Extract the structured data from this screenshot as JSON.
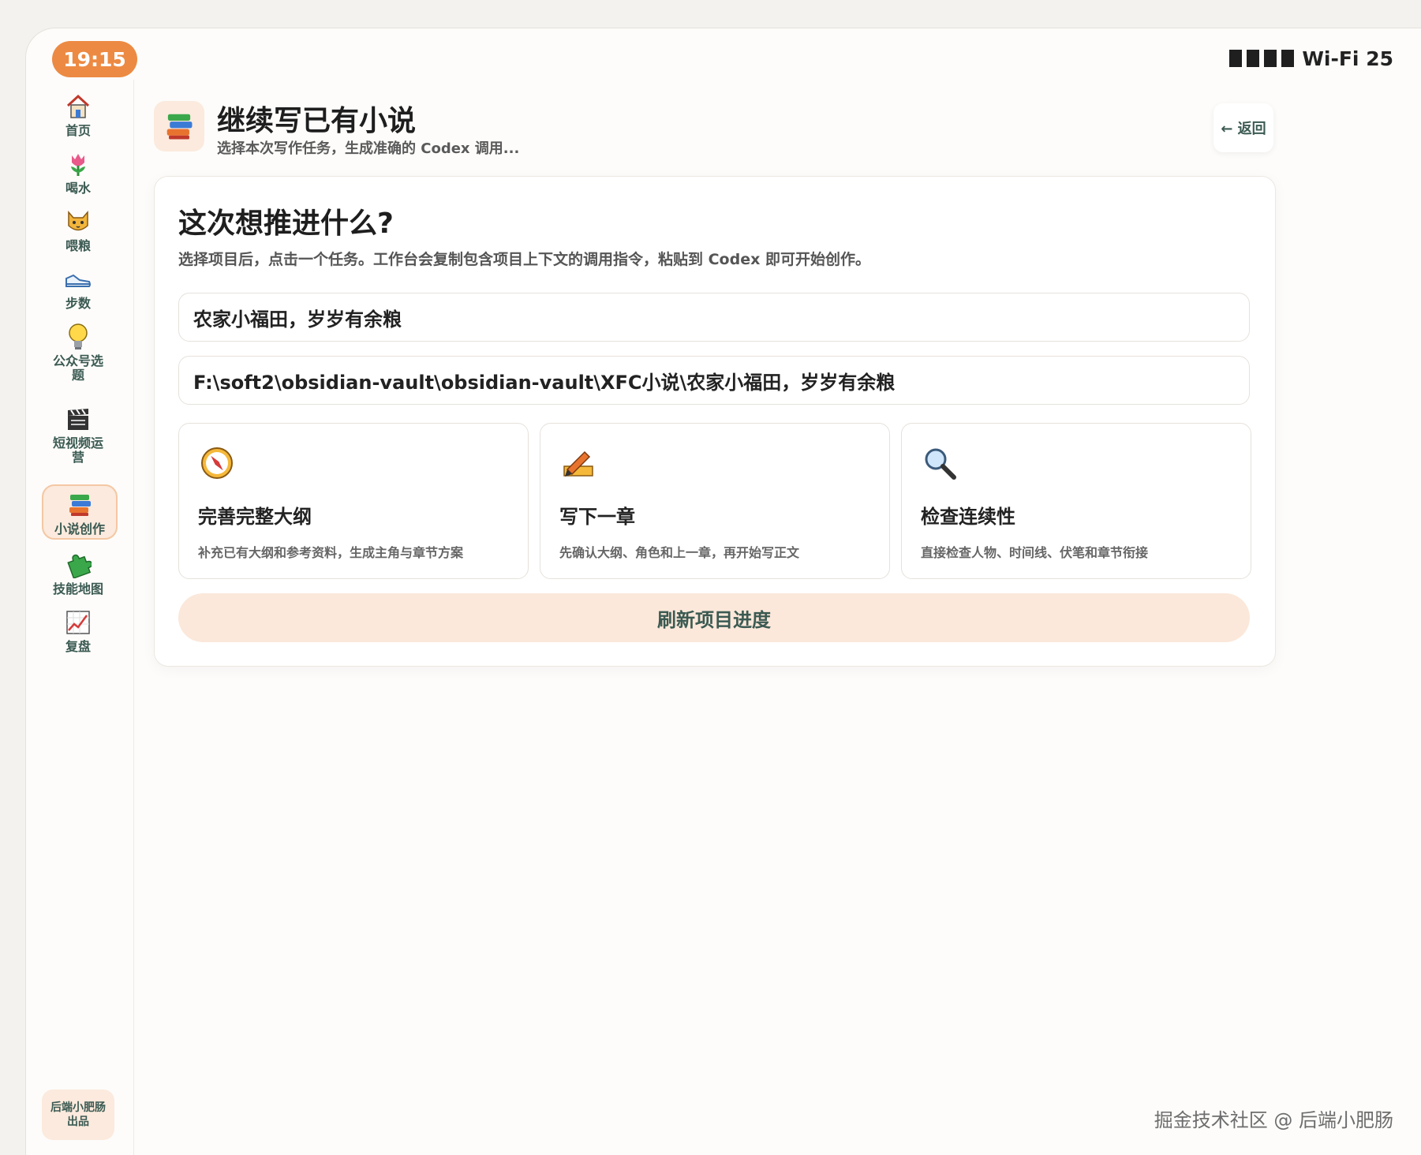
{
  "status": {
    "time": "19:15",
    "network": "Wi-Fi 25"
  },
  "sidebar": {
    "items": [
      {
        "label": "首页",
        "icon": "house-icon"
      },
      {
        "label": "喝水",
        "icon": "tulip-icon"
      },
      {
        "label": "喂粮",
        "icon": "cat-face-icon"
      },
      {
        "label": "步数",
        "icon": "sneaker-icon"
      },
      {
        "label": "公众号选题",
        "icon": "lightbulb-icon"
      },
      {
        "label": "短视频运营",
        "icon": "clapper-board-icon"
      },
      {
        "label": "小说创作",
        "icon": "books-icon",
        "active": true
      },
      {
        "label": "技能地图",
        "icon": "puzzle-icon"
      },
      {
        "label": "复盘",
        "icon": "chart-up-icon"
      }
    ],
    "footer": "后端小肥肠出品"
  },
  "header": {
    "icon": "books-icon",
    "title": "继续写已有小说",
    "subtitle": "选择本次写作任务，生成准确的 Codex 调用...",
    "back_label": "← 返回"
  },
  "panel": {
    "title": "这次想推进什么?",
    "description": "选择项目后，点击一个任务。工作台会复制包含项目上下文的调用指令，粘贴到 Codex 即可开始创作。",
    "project_name": "农家小福田，岁岁有余粮",
    "project_path": "F:\\soft2\\obsidian-vault\\obsidian-vault\\XFC小说\\农家小福田，岁岁有余粮",
    "tasks": [
      {
        "icon": "compass-icon",
        "title": "完善完整大纲",
        "desc": "补充已有大纲和参考资料，生成主角与章节方案"
      },
      {
        "icon": "pencil-icon",
        "title": "写下一章",
        "desc": "先确认大纲、角色和上一章，再开始写正文"
      },
      {
        "icon": "magnifier-icon",
        "title": "检查连续性",
        "desc": "直接检查人物、时间线、伏笔和章节衔接"
      }
    ],
    "refresh_label": "刷新项目进度"
  },
  "watermark": "掘金技术社区 @ 后端小肥肠",
  "colors": {
    "accent": "#ec8a43",
    "accent_soft": "#fbeadd",
    "nav_text": "#3b5a52"
  }
}
